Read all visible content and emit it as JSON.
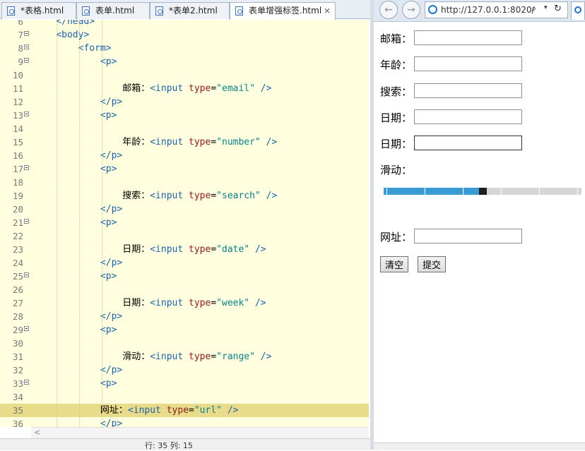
{
  "editor": {
    "tabs": [
      {
        "label": "*表格.html",
        "active": false
      },
      {
        "label": "表单.html",
        "active": false
      },
      {
        "label": "*表单2.html",
        "active": false
      },
      {
        "label": "表单增强标签.html",
        "active": true
      }
    ],
    "lines": [
      {
        "num": "6",
        "fold": false,
        "indent": 1,
        "code": "</head>",
        "partial": true
      },
      {
        "num": "7",
        "fold": true,
        "indent": 1,
        "code": "<body>"
      },
      {
        "num": "8",
        "fold": true,
        "indent": 2,
        "code": "<form>"
      },
      {
        "num": "9",
        "fold": true,
        "indent": 3,
        "code": "<p>"
      },
      {
        "num": "10",
        "fold": false,
        "indent": 0,
        "code": ""
      },
      {
        "num": "11",
        "fold": false,
        "indent": 4,
        "label": "邮箱：",
        "type": "email"
      },
      {
        "num": "12",
        "fold": false,
        "indent": 3,
        "code": "</p>"
      },
      {
        "num": "13",
        "fold": true,
        "indent": 3,
        "code": "<p>"
      },
      {
        "num": "14",
        "fold": false,
        "indent": 0,
        "code": ""
      },
      {
        "num": "15",
        "fold": false,
        "indent": 4,
        "label": "年龄：",
        "type": "number"
      },
      {
        "num": "16",
        "fold": false,
        "indent": 3,
        "code": "</p>"
      },
      {
        "num": "17",
        "fold": true,
        "indent": 3,
        "code": "<p>"
      },
      {
        "num": "18",
        "fold": false,
        "indent": 0,
        "code": ""
      },
      {
        "num": "19",
        "fold": false,
        "indent": 4,
        "label": "搜索：",
        "type": "search"
      },
      {
        "num": "20",
        "fold": false,
        "indent": 3,
        "code": "</p>"
      },
      {
        "num": "21",
        "fold": true,
        "indent": 3,
        "code": "<p>"
      },
      {
        "num": "22",
        "fold": false,
        "indent": 0,
        "code": ""
      },
      {
        "num": "23",
        "fold": false,
        "indent": 4,
        "label": "日期：",
        "type": "date"
      },
      {
        "num": "24",
        "fold": false,
        "indent": 3,
        "code": "</p>"
      },
      {
        "num": "25",
        "fold": true,
        "indent": 3,
        "code": "<p>"
      },
      {
        "num": "26",
        "fold": false,
        "indent": 0,
        "code": ""
      },
      {
        "num": "27",
        "fold": false,
        "indent": 4,
        "label": "日期：",
        "type": "week"
      },
      {
        "num": "28",
        "fold": false,
        "indent": 3,
        "code": "</p>"
      },
      {
        "num": "29",
        "fold": true,
        "indent": 3,
        "code": "<p>"
      },
      {
        "num": "30",
        "fold": false,
        "indent": 0,
        "code": ""
      },
      {
        "num": "31",
        "fold": false,
        "indent": 4,
        "label": "滑动：",
        "type": "range"
      },
      {
        "num": "32",
        "fold": false,
        "indent": 3,
        "code": "</p>"
      },
      {
        "num": "33",
        "fold": true,
        "indent": 3,
        "code": "<p>"
      },
      {
        "num": "34",
        "fold": false,
        "indent": 0,
        "code": ""
      },
      {
        "num": "35",
        "fold": false,
        "indent": 3,
        "label": "网址：",
        "type": "url",
        "highlight": true
      },
      {
        "num": "36",
        "fold": false,
        "indent": 3,
        "code": "</p>",
        "partial": true
      }
    ],
    "status_text": "行: 35 列: 15"
  },
  "browser": {
    "back_icon": "back-arrow-icon",
    "forward_icon": "forward-arrow-icon",
    "back_glyph": "←",
    "forward_glyph": "→",
    "address": "http://127.0.0.1:8020/",
    "search_glyph": "⌕",
    "dropdown_glyph": "▾",
    "refresh_glyph": "↻",
    "form": {
      "email_label": "邮箱：",
      "age_label": "年龄：",
      "search_label": "搜索：",
      "date_label": "日期：",
      "week_label": "日期：",
      "range_label": "滑动：",
      "range_value": 0.5,
      "url_label": "网址：",
      "reset_label": "清空",
      "submit_label": "提交"
    },
    "colors": {
      "range_fill": "#3a9bd3",
      "range_thumb": "#1e1e1e"
    }
  }
}
